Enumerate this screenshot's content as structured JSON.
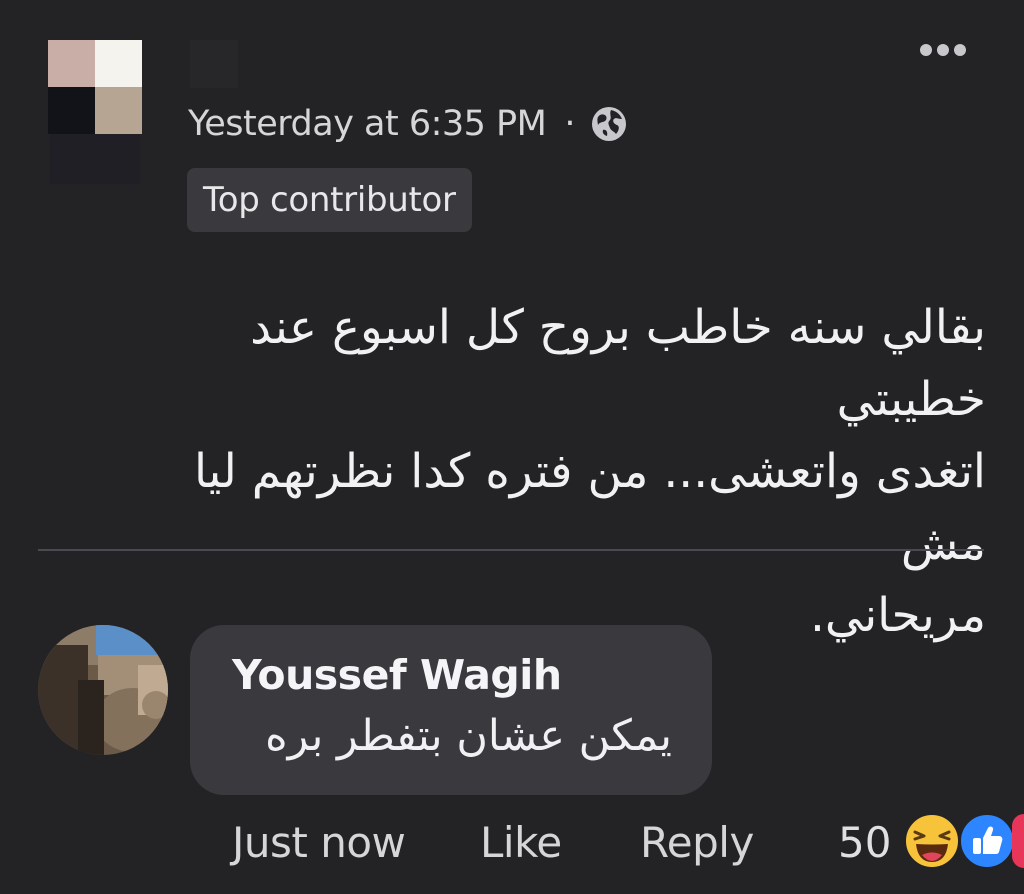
{
  "post": {
    "timestamp": "Yesterday at 6:35 PM",
    "separator": "·",
    "audience_icon": "globe-icon",
    "badge": "Top contributor",
    "more_icon": "more-options-icon",
    "text_lines": [
      "بقالي سنه خاطب بروح كل اسبوع عند خطيبتي",
      "اتغدى واتعشى... من فتره كدا نظرتهم ليا مش",
      "مريحاني."
    ]
  },
  "comment": {
    "author": "Youssef Wagih",
    "text": "يمكن عشان بتفطر بره",
    "actions": {
      "time": "Just now",
      "like": "Like",
      "reply": "Reply"
    },
    "reaction_count": "50",
    "reaction_icons": [
      "haha-reaction-icon",
      "like-reaction-icon",
      "love-reaction-icon"
    ]
  },
  "colors": {
    "background": "#232326",
    "bubble": "#3a3a3e",
    "like_blue": "#2d86ff",
    "haha_yellow": "#f7c33a"
  }
}
